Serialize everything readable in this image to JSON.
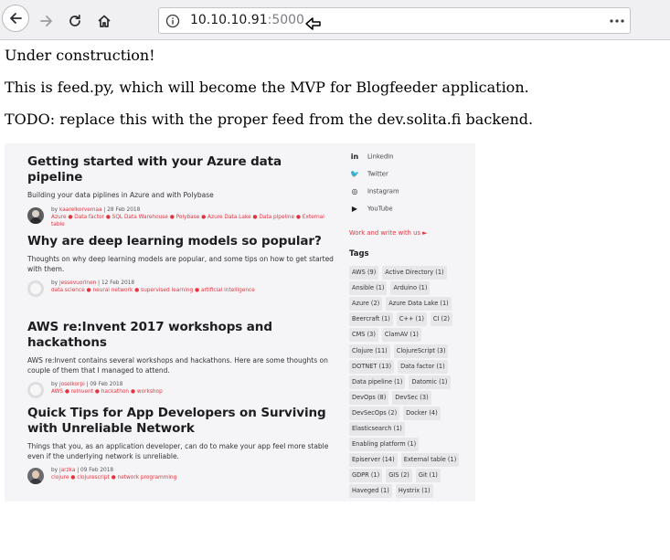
{
  "browser": {
    "url_host": "10.10.10.91",
    "url_port": ":5000"
  },
  "page": {
    "lines": [
      "Under construction!",
      "This is feed.py, which will become the MVP for Blogfeeder application.",
      "TODO: replace this with the proper feed from the dev.solita.fi backend."
    ]
  },
  "embedded": {
    "posts": [
      {
        "title": "Getting started with your Azure data pipeline",
        "excerpt": "Building your data piplines in Azure and with Polybase",
        "author": "kaarelkorvemaa",
        "date": "28 Feb 2018",
        "tags": "Azure ● Data factor ● SQL Data Warehouse ● Polybase ● Azure Data Lake ● Data pipeline ● External table"
      },
      {
        "title": "Why are deep learning models so popular?",
        "excerpt": "Thoughts on why deep learning models are popular, and some tips on how to get started with them.",
        "author": "jessevuorinen",
        "date": "12 Feb 2018",
        "tags": "data science ● neural network ● supervised learning ● artificial intelligence"
      },
      {
        "title": "AWS re:Invent 2017 workshops and hackathons",
        "excerpt": "AWS re:Invent contains several workshops and hackathons. Here are some thoughts on couple of them that I managed to attend.",
        "author": "joselkorpi",
        "date": "09 Feb 2018",
        "tags": "AWS ● reInvent ● hackathon ● workshop"
      },
      {
        "title": "Quick Tips for App Developers on Surviving with Unreliable Network",
        "excerpt": "Things that you, as an application developer, can do to make your app feel more stable even if the underlying network is unreliable.",
        "author": "jarzka",
        "date": "09 Feb 2018",
        "tags": "clojure ● clojurescript ● network programming"
      }
    ],
    "by_prefix": "by",
    "social": [
      "LinkedIn",
      "Twitter",
      "Instagram",
      "YouTube"
    ],
    "work_link": "Work and write with us ►",
    "tags_heading": "Tags",
    "tag_rows": [
      [
        "AWS (9)",
        "Active Directory (1)"
      ],
      [
        "Ansible (1)",
        "Arduino (1)"
      ],
      [
        "Azure (2)",
        "Azure Data Lake (1)"
      ],
      [
        "Beercraft (1)",
        "C++ (1)",
        "CI (2)"
      ],
      [
        "CMS (3)",
        "ClamAV (1)"
      ],
      [
        "Clojure (11)",
        "ClojureScript (3)"
      ],
      [
        "DOTNET (13)",
        "Data factor (1)"
      ],
      [
        "Data pipeline (1)",
        "Datomic (1)"
      ],
      [
        "DevOps (8)",
        "DevSec (3)"
      ],
      [
        "DevSecOps (2)",
        "Docker (4)"
      ],
      [
        "Elasticsearch (1)"
      ],
      [
        "Enabling platform (1)"
      ],
      [
        "Episerver (14)",
        "External table (1)"
      ],
      [
        "GDPR (1)",
        "GIS (2)",
        "Git (1)"
      ],
      [
        "Haveged (1)",
        "Hystrix (1)"
      ]
    ]
  }
}
